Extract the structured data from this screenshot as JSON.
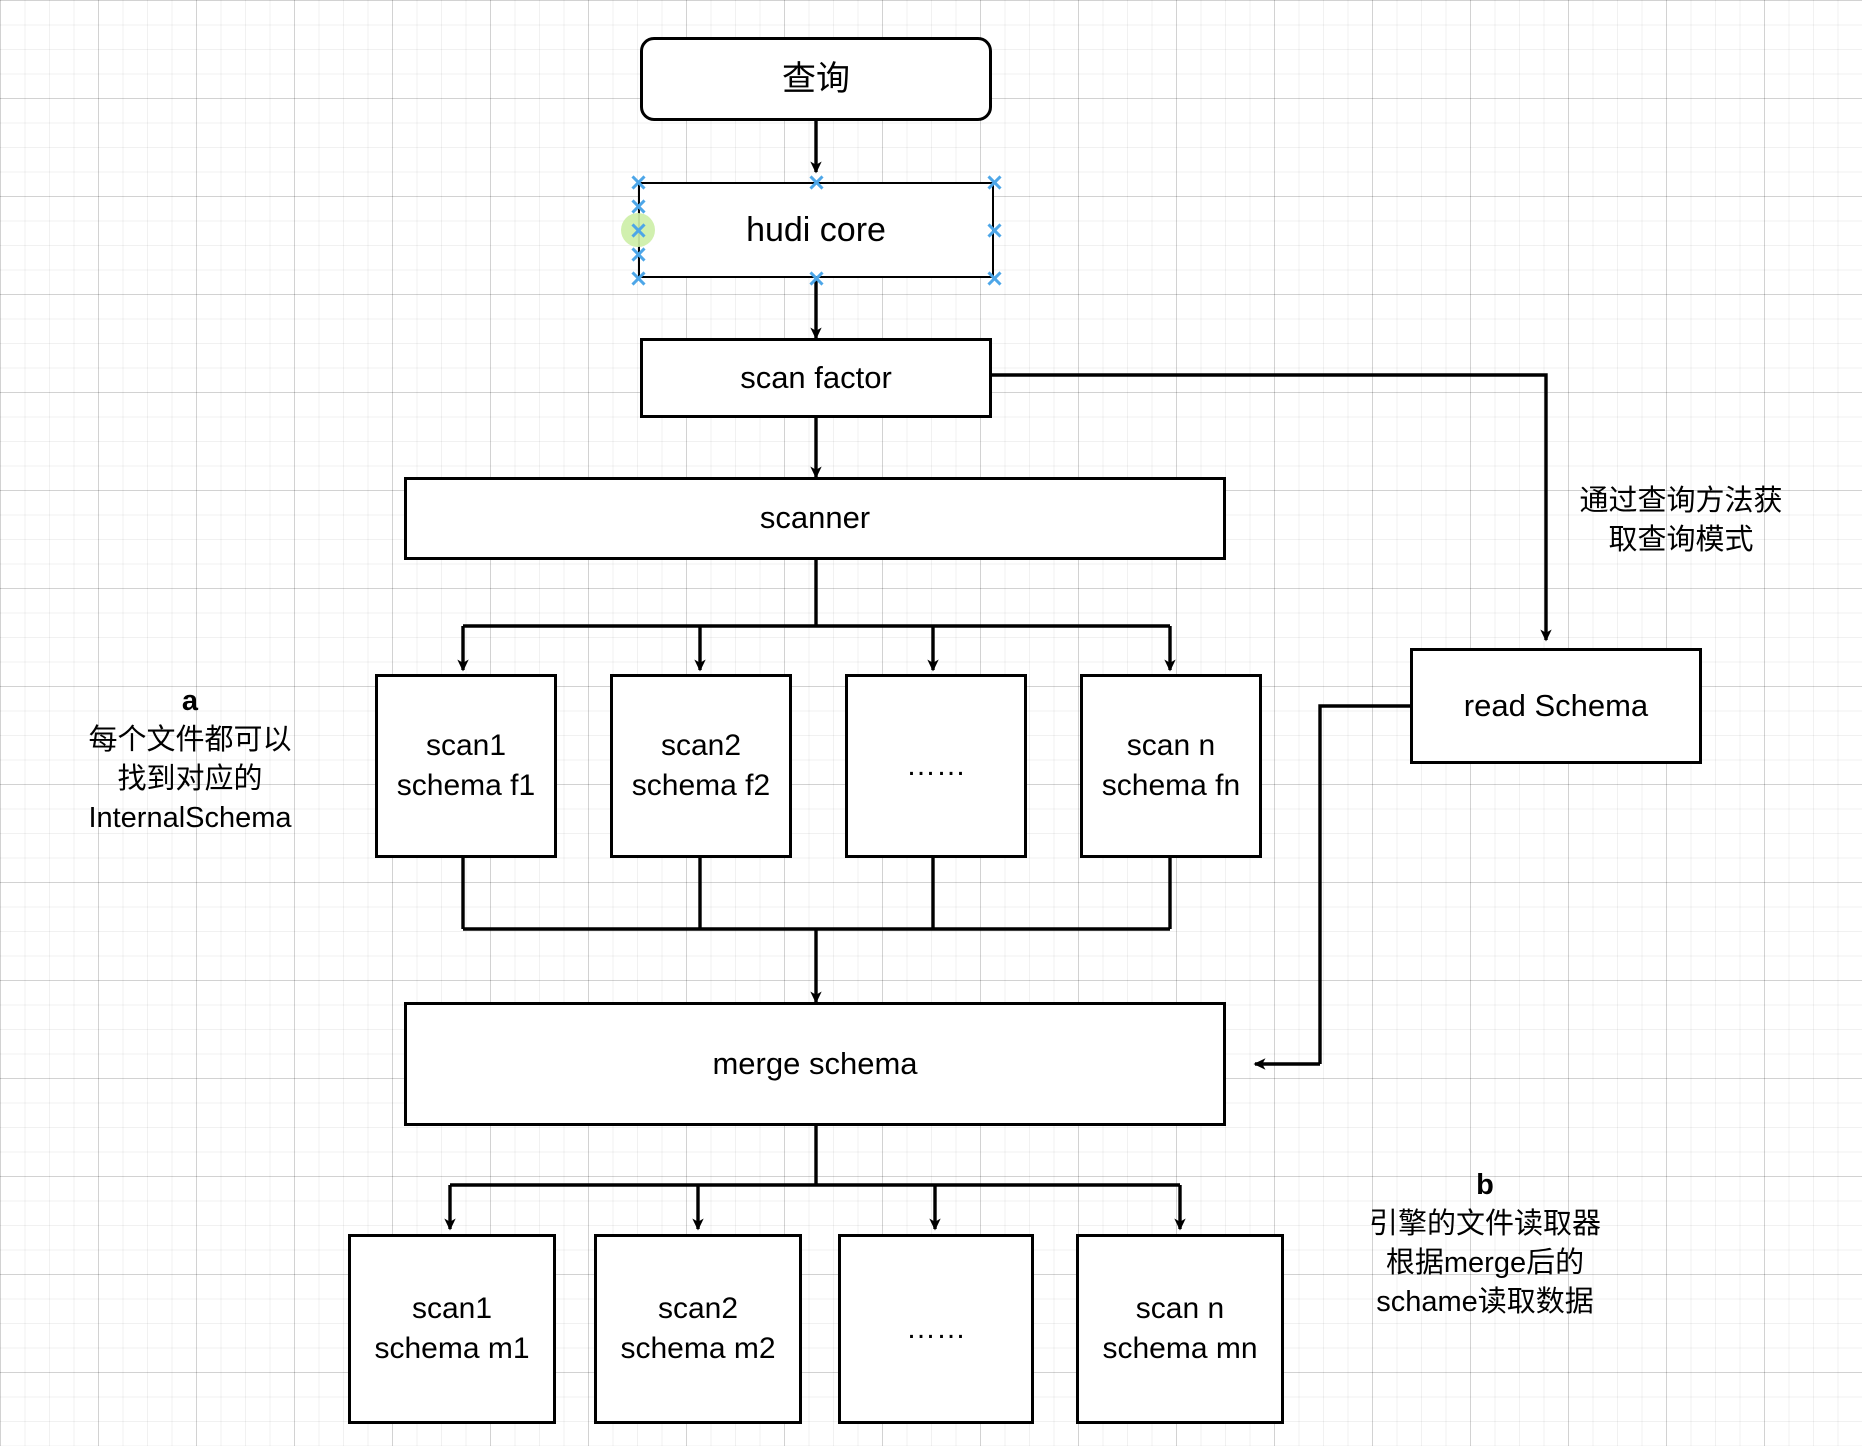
{
  "diagram": {
    "title_node": {
      "label": "查询"
    },
    "nodes": [
      {
        "id": "query",
        "label": "查询",
        "shape": "rounded"
      },
      {
        "id": "hudi_core",
        "label": "hudi core",
        "shape": "rect-selected"
      },
      {
        "id": "scan_factor",
        "label": "scan factor",
        "shape": "rect"
      },
      {
        "id": "scanner",
        "label": "scanner",
        "shape": "rect"
      },
      {
        "id": "read_schema",
        "label": "read Schema",
        "shape": "rect"
      },
      {
        "id": "merge_schema",
        "label": "merge schema",
        "shape": "rect"
      }
    ],
    "scan_row_f": [
      {
        "line1": "scan1",
        "line2": "schema f1"
      },
      {
        "line1": "scan2",
        "line2": "schema f2"
      },
      {
        "line1": "……",
        "line2": ""
      },
      {
        "line1": "scan n",
        "line2": "schema fn"
      }
    ],
    "scan_row_m": [
      {
        "line1": "scan1",
        "line2": "schema m1"
      },
      {
        "line1": "scan2",
        "line2": "schema m2"
      },
      {
        "line1": "……",
        "line2": ""
      },
      {
        "line1": "scan n",
        "line2": "schema mn"
      }
    ],
    "annotations": {
      "right_top": {
        "line1": "通过查询方法获",
        "line2": "取查询模式"
      },
      "note_a": {
        "tag": "a",
        "line1": "每个文件都可以",
        "line2": "找到对应的",
        "line3": "InternalSchema"
      },
      "note_b": {
        "tag": "b",
        "line1": "引擎的文件读取器",
        "line2": "根据merge后的",
        "line3": "schame读取数据"
      }
    },
    "selection": {
      "selected_node": "hudi core",
      "handle_color": "#4DA6E8",
      "connect_point_color": "#CDEFA8"
    },
    "colors": {
      "stroke": "#000000",
      "fill": "#FFFFFF",
      "grid_minor": "#EFEFEF",
      "grid_major": "#DCDCDC"
    }
  }
}
